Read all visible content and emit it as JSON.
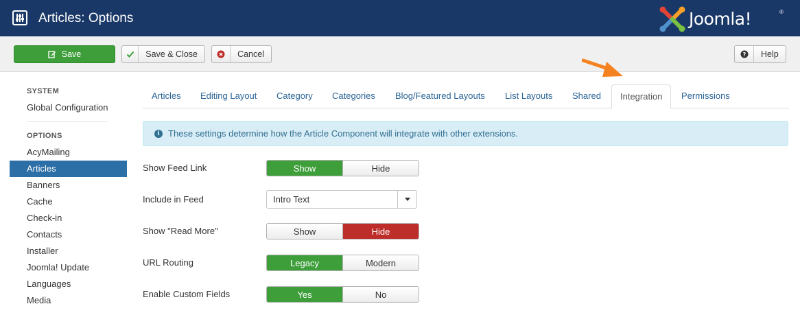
{
  "header": {
    "title": "Articles: Options",
    "icon": "options-sliders-icon",
    "logo_text": "Joomla!",
    "logo_reg": "®",
    "colors": {
      "bar": "#1a3867",
      "logo_red": "#e24436",
      "logo_orange": "#f7a029",
      "logo_green": "#7ac143",
      "logo_blue": "#5091cd"
    }
  },
  "toolbar": {
    "save_label": "Save",
    "save_close_label": "Save & Close",
    "cancel_label": "Cancel",
    "help_label": "Help"
  },
  "sidebar": {
    "system_heading": "SYSTEM",
    "system_items": [
      {
        "label": "Global Configuration"
      }
    ],
    "options_heading": "OPTIONS",
    "items": [
      {
        "label": "AcyMailing"
      },
      {
        "label": "Articles",
        "active": true
      },
      {
        "label": "Banners"
      },
      {
        "label": "Cache"
      },
      {
        "label": "Check-in"
      },
      {
        "label": "Contacts"
      },
      {
        "label": "Installer"
      },
      {
        "label": "Joomla! Update"
      },
      {
        "label": "Languages"
      },
      {
        "label": "Media"
      }
    ]
  },
  "tabs": [
    {
      "label": "Articles"
    },
    {
      "label": "Editing Layout"
    },
    {
      "label": "Category"
    },
    {
      "label": "Categories"
    },
    {
      "label": "Blog/Featured Layouts"
    },
    {
      "label": "List Layouts"
    },
    {
      "label": "Shared"
    },
    {
      "label": "Integration",
      "active": true
    },
    {
      "label": "Permissions"
    }
  ],
  "alert": {
    "text": "These settings determine how the Article Component will integrate with other extensions."
  },
  "form": {
    "show_feed_link": {
      "label": "Show Feed Link",
      "options": [
        "Show",
        "Hide"
      ],
      "selected": "Show"
    },
    "include_in_feed": {
      "label": "Include in Feed",
      "value": "Intro Text"
    },
    "show_read_more": {
      "label": "Show \"Read More\"",
      "options": [
        "Show",
        "Hide"
      ],
      "selected": "Hide"
    },
    "url_routing": {
      "label": "URL Routing",
      "options": [
        "Legacy",
        "Modern"
      ],
      "selected": "Legacy"
    },
    "enable_custom_fields": {
      "label": "Enable Custom Fields",
      "options": [
        "Yes",
        "No"
      ],
      "selected": "Yes"
    }
  },
  "colors": {
    "green": "#3e9e3a",
    "red": "#bd2e2a",
    "link": "#2a6496",
    "active_sidebar": "#2c6ea6",
    "arrow": "#f58220",
    "alert_bg": "#d9edf7"
  }
}
